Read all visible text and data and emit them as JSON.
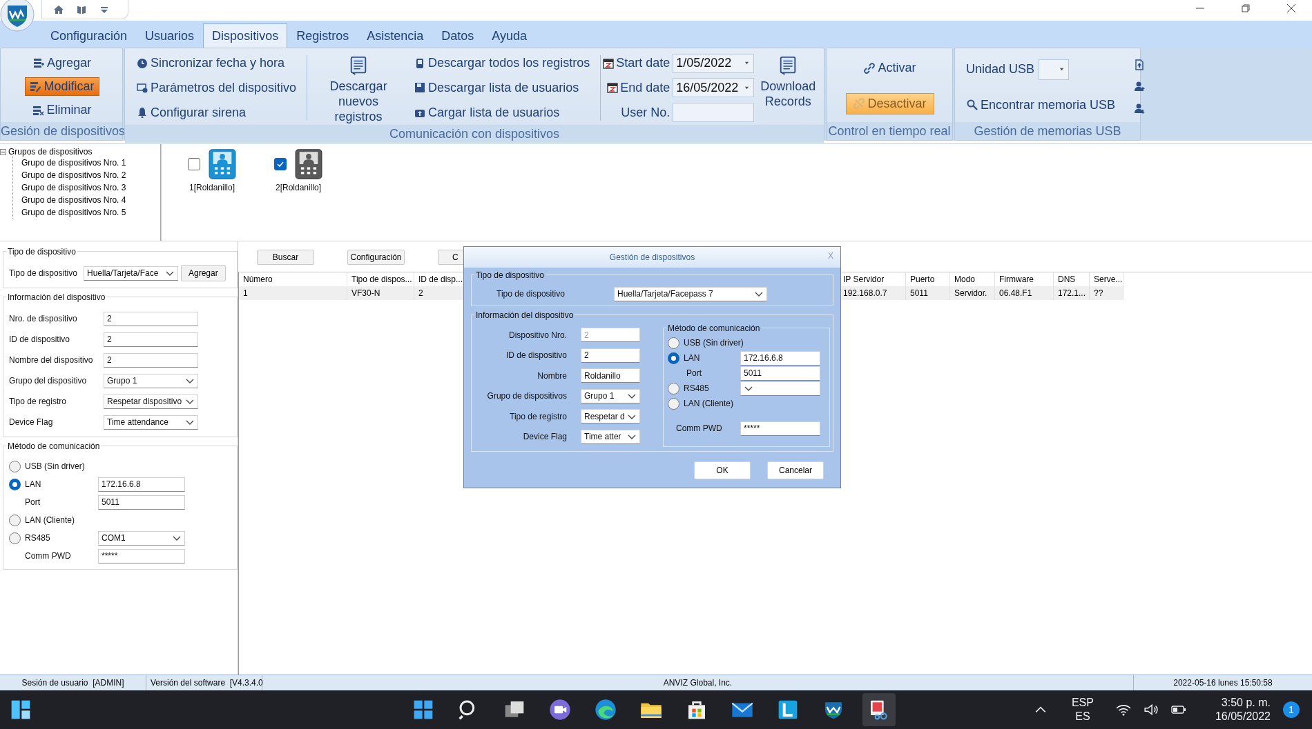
{
  "menu_tabs": [
    {
      "label": "Configuración",
      "selected": false
    },
    {
      "label": "Usuarios",
      "selected": false
    },
    {
      "label": "Dispositivos",
      "selected": true
    },
    {
      "label": "Registros",
      "selected": false
    },
    {
      "label": "Asistencia",
      "selected": false
    },
    {
      "label": "Datos",
      "selected": false
    },
    {
      "label": "Ayuda",
      "selected": false
    }
  ],
  "ribbon": {
    "device_group": {
      "title": "Gesión de dispositivos",
      "buttons": [
        {
          "label": "Agregar",
          "active": false
        },
        {
          "label": "Modificar",
          "active": true
        },
        {
          "label": "Eliminar",
          "active": false
        }
      ]
    },
    "communication": {
      "title": "Comunicación con dispositivos",
      "settings": [
        "Sincronizar fecha y hora",
        "Parámetros del dispositivo",
        "Configurar sirena"
      ],
      "download_new": "Descargar nuevos registros",
      "transfers": [
        "Descargar todos los registros",
        "Descargar lista de usuarios",
        "Cargar lista de usuarios"
      ],
      "start_date": {
        "label": "Start date",
        "value": "1/05/2022"
      },
      "end_date": {
        "label": "End date",
        "value": "16/05/2022"
      },
      "user_no": {
        "label": "User No."
      },
      "download_records": "Download Records"
    },
    "realtime": {
      "title": "Control en tiempo real",
      "activate": "Activar",
      "deactivate": "Desactivar"
    },
    "usb": {
      "title": "Gestión de memorias USB",
      "drive_label": "Unidad USB",
      "find": "Encontrar memoria USB"
    }
  },
  "device_tree": {
    "root": "Grupos de dispositivos",
    "expanded": true,
    "children": [
      {
        "label": "Grupo de dispositivos Nro. 1"
      },
      {
        "label": "Grupo de dispositivos Nro. 2"
      },
      {
        "label": "Grupo de dispositivos Nro. 3"
      },
      {
        "label": "Grupo de dispositivos Nro. 4"
      },
      {
        "label": "Grupo de dispositivos Nro. 5"
      }
    ]
  },
  "devices": [
    {
      "label": "1[Roldanillo]",
      "checked": false,
      "online": true
    },
    {
      "label": "2[Roldanillo]",
      "checked": true,
      "online": false
    }
  ],
  "device_form": {
    "type_section": {
      "title": "Tipo de dispositivo",
      "label": "Tipo de dispositivo",
      "value": "Huella/Tarjeta/Face",
      "add_button": "Agregar"
    },
    "info_section": {
      "title": "Información del dispositivo",
      "fields": [
        {
          "label": "Nro. de dispositivo",
          "kind": "input",
          "value": "2",
          "disabled": false
        },
        {
          "label": "ID de dispositivo",
          "kind": "input",
          "value": "2",
          "disabled": false
        },
        {
          "label": "Nombre del dispositivo",
          "kind": "input",
          "value": "2",
          "disabled": false
        },
        {
          "label": "Grupo del dispositivo",
          "kind": "select",
          "value": "Grupo 1",
          "disabled": false
        },
        {
          "label": "Tipo de registro",
          "kind": "select",
          "value": "Respetar dispositivo",
          "disabled": false
        },
        {
          "label": "Device Flag",
          "kind": "select",
          "value": "Time attendance",
          "disabled": false
        }
      ]
    },
    "comm_section": {
      "title": "Método de comunicación",
      "rows": [
        {
          "kind": "radio",
          "label": "USB (Sin driver)",
          "selected": false
        },
        {
          "kind": "radio_input",
          "label": "LAN",
          "selected": true,
          "value": "172.16.6.8"
        },
        {
          "kind": "input",
          "label": "Port",
          "value": "5011"
        },
        {
          "kind": "radio",
          "label": "LAN (Cliente)",
          "selected": false
        },
        {
          "kind": "radio_select",
          "label": "RS485",
          "selected": false,
          "value": "COM1"
        },
        {
          "kind": "input",
          "label": "Comm PWD",
          "value": "*****"
        }
      ]
    }
  },
  "list_buttons": [
    "Buscar",
    "Configuración",
    "C"
  ],
  "table": {
    "columns": [
      "Número",
      "Tipo de dispos...",
      "ID de disp...",
      "IP Servidor",
      "Puerto",
      "Modo",
      "Firmware",
      "DNS",
      "Serve..."
    ],
    "rows": [
      [
        "1",
        "VF30-N",
        "2",
        "192.168.0.7",
        "5011",
        "Servidor.",
        "06.48.F1",
        "172.1...",
        "??"
      ]
    ]
  },
  "dialog": {
    "title": "Gestión de dispositivos",
    "close": "X",
    "type_section": {
      "title": "Tipo de dispositivo",
      "label": "Tipo de dispositivo",
      "value": "Huella/Tarjeta/Facepass 7"
    },
    "info_section": {
      "title": "Información del dispositivo",
      "fields": [
        {
          "label": "Dispositivo Nro.",
          "kind": "input",
          "value": "2",
          "disabled": true
        },
        {
          "label": "ID de dispositivo",
          "kind": "input",
          "value": "2",
          "disabled": false
        },
        {
          "label": "Nombre",
          "kind": "input",
          "value": "Roldanillo",
          "disabled": false
        },
        {
          "label": "Grupo de dispositivos",
          "kind": "select",
          "value": "Grupo 1",
          "disabled": false
        },
        {
          "label": "Tipo de registro",
          "kind": "select",
          "value": "Respetar d",
          "disabled": false
        },
        {
          "label": "Device Flag",
          "kind": "select",
          "value": "Time atter",
          "disabled": false
        }
      ]
    },
    "comm_section": {
      "title": "Método de comunicación",
      "rows": [
        {
          "kind": "radio",
          "label": "USB (Sin driver)",
          "selected": false
        },
        {
          "kind": "radio_input",
          "label": "LAN",
          "selected": true,
          "value": "172.16.6.8"
        },
        {
          "kind": "input",
          "label": "Port",
          "value": "5011"
        },
        {
          "kind": "radio_select",
          "label": "RS485",
          "selected": false
        },
        {
          "kind": "radio",
          "label": "LAN (Cliente)",
          "selected": false
        },
        {
          "kind": "input",
          "label": "Comm PWD",
          "value": "*****"
        }
      ]
    },
    "buttons": [
      "OK",
      "Cancelar"
    ]
  },
  "status_bar": [
    "Sesión de usuario  [ADMIN]",
    "Versión del software  [V4.3.4.0",
    "ANVIZ Global, Inc.",
    "2022-05-16 lunes 15:50:58"
  ],
  "taskbar": {
    "language": "ESP",
    "layout": "ES",
    "time": "3:50 p. m.",
    "date": "16/05/2022",
    "notifications": "1"
  }
}
